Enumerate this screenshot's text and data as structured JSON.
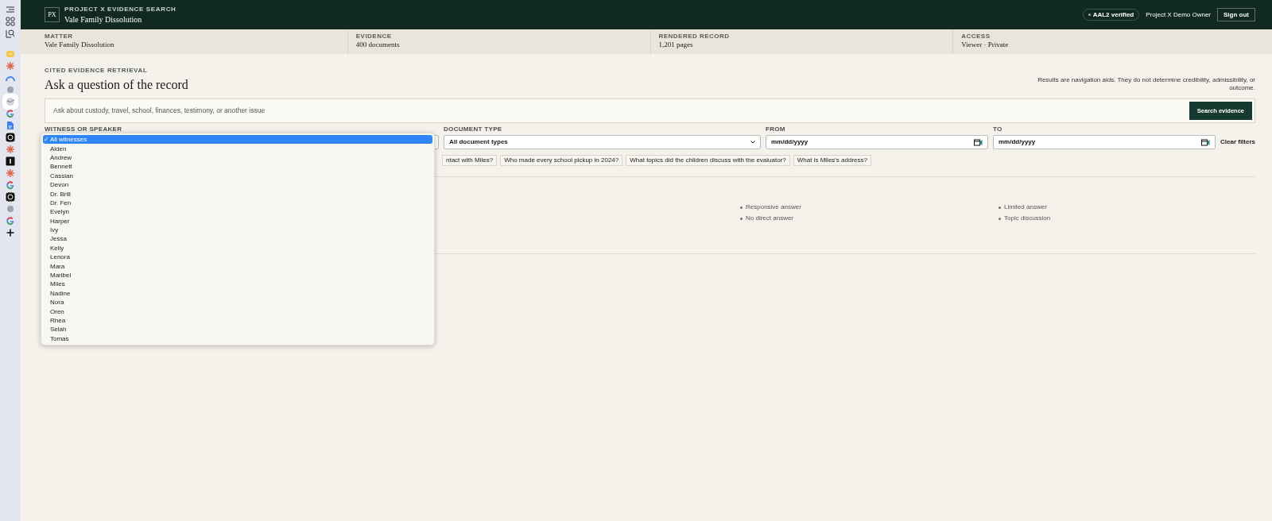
{
  "header": {
    "logo": "PX",
    "eyebrow": "PROJECT X EVIDENCE SEARCH",
    "title": "Vale Family Dissolution",
    "badge": "AAL2 verified",
    "user": "Project X Demo Owner",
    "sign_out": "Sign out"
  },
  "summary": [
    {
      "label": "MATTER",
      "value": "Vale Family Dissolution"
    },
    {
      "label": "EVIDENCE",
      "value": "400 documents"
    },
    {
      "label": "RENDERED RECORD",
      "value": "1,201 pages"
    },
    {
      "label": "ACCESS",
      "value": "Viewer · Private"
    }
  ],
  "main": {
    "eyebrow": "CITED EVIDENCE RETRIEVAL",
    "title": "Ask a question of the record",
    "disclaimer": "Results are navigation aids. They do not determine credibility, admissibility, or outcome.",
    "search": {
      "placeholder": "Ask about custody, travel, school, finances, testimony, or another issue",
      "button": "Search evidence"
    }
  },
  "filters": {
    "witness_label": "WITNESS OR SPEAKER",
    "document_type": {
      "label": "DOCUMENT TYPE",
      "value": "All document types"
    },
    "from": {
      "label": "FROM",
      "placeholder": "mm/dd/yyyy"
    },
    "to": {
      "label": "TO",
      "placeholder": "mm/dd/yyyy"
    },
    "clear": "Clear filters"
  },
  "suggestions": [
    "ntact with Miles?",
    "Who made every school pickup in 2024?",
    "What topics did the children discuss with the evaluator?",
    "What is Miles's address?"
  ],
  "legend": [
    {
      "label": "Responsive answer",
      "color": "#6b7568"
    },
    {
      "label": "No direct answer",
      "color": "#6b7568"
    },
    {
      "label": "Limited answer",
      "color": "#6b7568"
    },
    {
      "label": "Topic discussion",
      "color": "#6b7568"
    }
  ],
  "witness_menu_check": "✓",
  "witness_menu": [
    {
      "label": "All witnesses",
      "selected": true
    },
    {
      "label": "Alden",
      "selected": false
    },
    {
      "label": "Andrew",
      "selected": false
    },
    {
      "label": "Bennett",
      "selected": false
    },
    {
      "label": "Cassian",
      "selected": false
    },
    {
      "label": "Devon",
      "selected": false
    },
    {
      "label": "Dr. Brill",
      "selected": false
    },
    {
      "label": "Dr. Fen",
      "selected": false
    },
    {
      "label": "Evelyn",
      "selected": false
    },
    {
      "label": "Harper",
      "selected": false
    },
    {
      "label": "Ivy",
      "selected": false
    },
    {
      "label": "Jessa",
      "selected": false
    },
    {
      "label": "Kelly",
      "selected": false
    },
    {
      "label": "Lenora",
      "selected": false
    },
    {
      "label": "Mara",
      "selected": false
    },
    {
      "label": "Maribel",
      "selected": false
    },
    {
      "label": "Miles",
      "selected": false
    },
    {
      "label": "Nadine",
      "selected": false
    },
    {
      "label": "Nora",
      "selected": false
    },
    {
      "label": "Oren",
      "selected": false
    },
    {
      "label": "Rhea",
      "selected": false
    },
    {
      "label": "Selah",
      "selected": false
    },
    {
      "label": "Tomas",
      "selected": false
    }
  ]
}
